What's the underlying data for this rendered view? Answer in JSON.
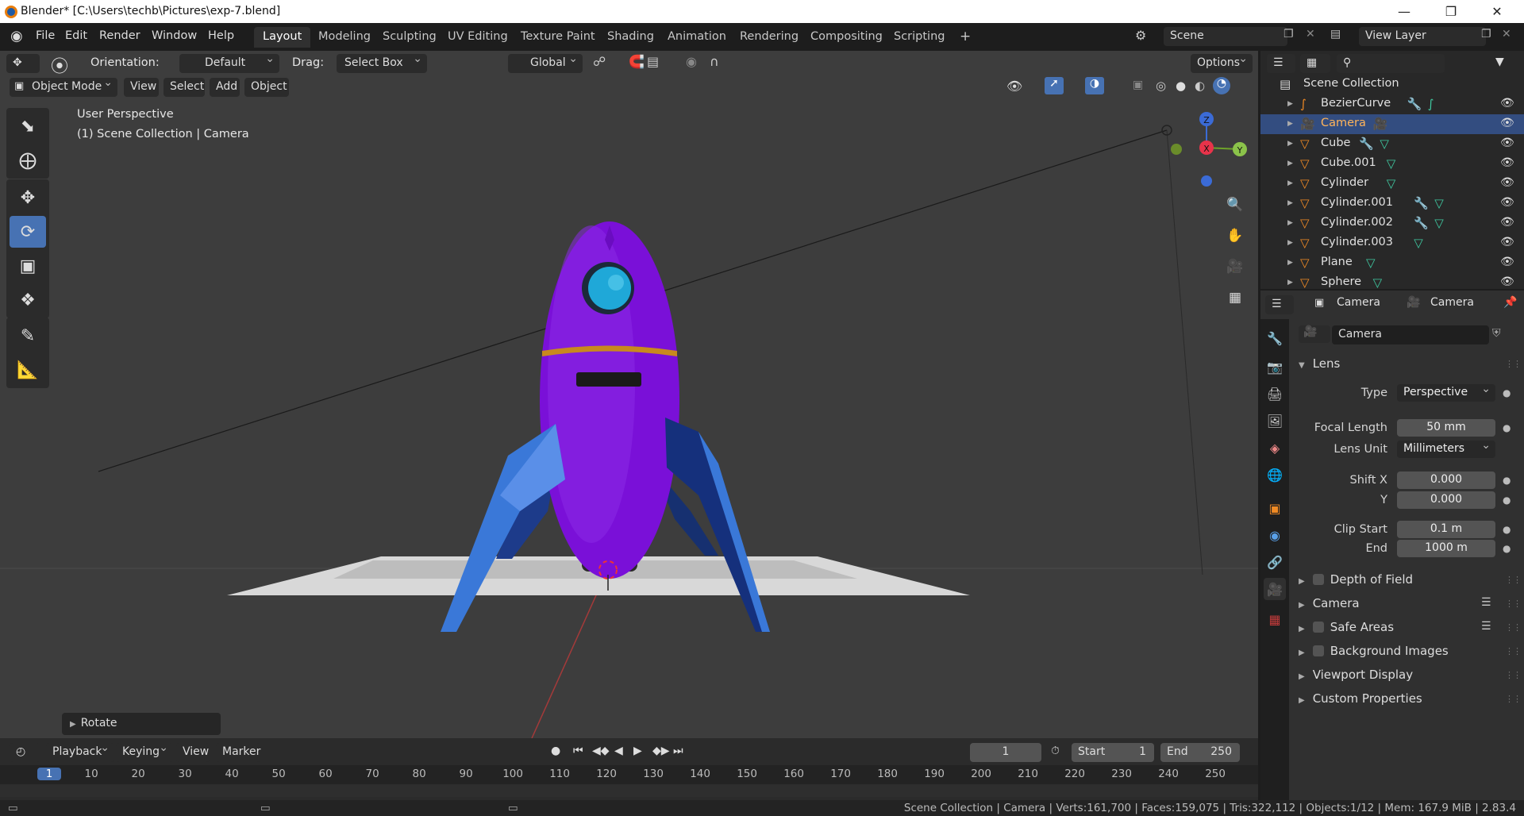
{
  "window": {
    "title": "Blender* [C:\\Users\\techb\\Pictures\\exp-7.blend]"
  },
  "menu": [
    "File",
    "Edit",
    "Render",
    "Window",
    "Help"
  ],
  "workspaces": [
    "Layout",
    "Modeling",
    "Sculpting",
    "UV Editing",
    "Texture Paint",
    "Shading",
    "Animation",
    "Rendering",
    "Compositing",
    "Scripting"
  ],
  "scene": {
    "name": "Scene",
    "view_layer": "View Layer"
  },
  "tool_header": {
    "orientation_label": "Orientation:",
    "orientation_value": "Default",
    "drag_label": "Drag:",
    "drag_value": "Select Box",
    "transform": "Global",
    "options": "Options"
  },
  "viewport_header": {
    "mode": "Object Mode",
    "menus": [
      "View",
      "Select",
      "Add",
      "Object"
    ]
  },
  "viewport": {
    "perspective": "User Perspective",
    "context": "(1) Scene Collection | Camera",
    "last_op": "Rotate"
  },
  "gizmo": {
    "x": "X",
    "y": "Y",
    "z": "Z"
  },
  "outliner": {
    "root": "Scene Collection",
    "items": [
      {
        "name": "BezierCurve",
        "icon": "curve-icon",
        "selected": false
      },
      {
        "name": "Camera",
        "icon": "camera-icon",
        "selected": true
      },
      {
        "name": "Cube",
        "icon": "mesh-icon",
        "selected": false
      },
      {
        "name": "Cube.001",
        "icon": "mesh-icon",
        "selected": false
      },
      {
        "name": "Cylinder",
        "icon": "mesh-icon",
        "selected": false
      },
      {
        "name": "Cylinder.001",
        "icon": "mesh-icon",
        "selected": false
      },
      {
        "name": "Cylinder.002",
        "icon": "mesh-icon",
        "selected": false
      },
      {
        "name": "Cylinder.003",
        "icon": "mesh-icon",
        "selected": false
      },
      {
        "name": "Plane",
        "icon": "mesh-icon",
        "selected": false
      },
      {
        "name": "Sphere",
        "icon": "mesh-icon",
        "selected": false
      }
    ]
  },
  "properties": {
    "breadcrumb": [
      "Camera",
      "Camera"
    ],
    "data_name": "Camera",
    "lens_section": "Lens",
    "type_label": "Type",
    "type_value": "Perspective",
    "focal_label": "Focal Length",
    "focal_value": "50 mm",
    "lens_unit_label": "Lens Unit",
    "lens_unit_value": "Millimeters",
    "shift_x_label": "Shift X",
    "shift_x_value": "0.000",
    "shift_y_label": "Y",
    "shift_y_value": "0.000",
    "clip_start_label": "Clip Start",
    "clip_start_value": "0.1 m",
    "clip_end_label": "End",
    "clip_end_value": "1000 m",
    "panels": [
      "Depth of Field",
      "Camera",
      "Safe Areas",
      "Background Images",
      "Viewport Display",
      "Custom Properties"
    ]
  },
  "timeline": {
    "menus": [
      "Playback",
      "Keying",
      "View",
      "Marker"
    ],
    "current_frame": "1",
    "start_label": "Start",
    "start": "1",
    "end_label": "End",
    "end": "250",
    "ticks": [
      "1",
      "10",
      "20",
      "30",
      "40",
      "50",
      "60",
      "70",
      "80",
      "90",
      "100",
      "110",
      "120",
      "130",
      "140",
      "150",
      "160",
      "170",
      "180",
      "190",
      "200",
      "210",
      "220",
      "230",
      "240",
      "250"
    ]
  },
  "status": "Scene Collection | Camera | Verts:161,700 | Faces:159,075 | Tris:322,112 | Objects:1/12 | Mem: 167.9 MiB | 2.83.4",
  "colors": {
    "accent": "#4772b3",
    "rocket_body": "#7a10d8",
    "fins": "#3a78d8",
    "selection": "#334d80"
  }
}
